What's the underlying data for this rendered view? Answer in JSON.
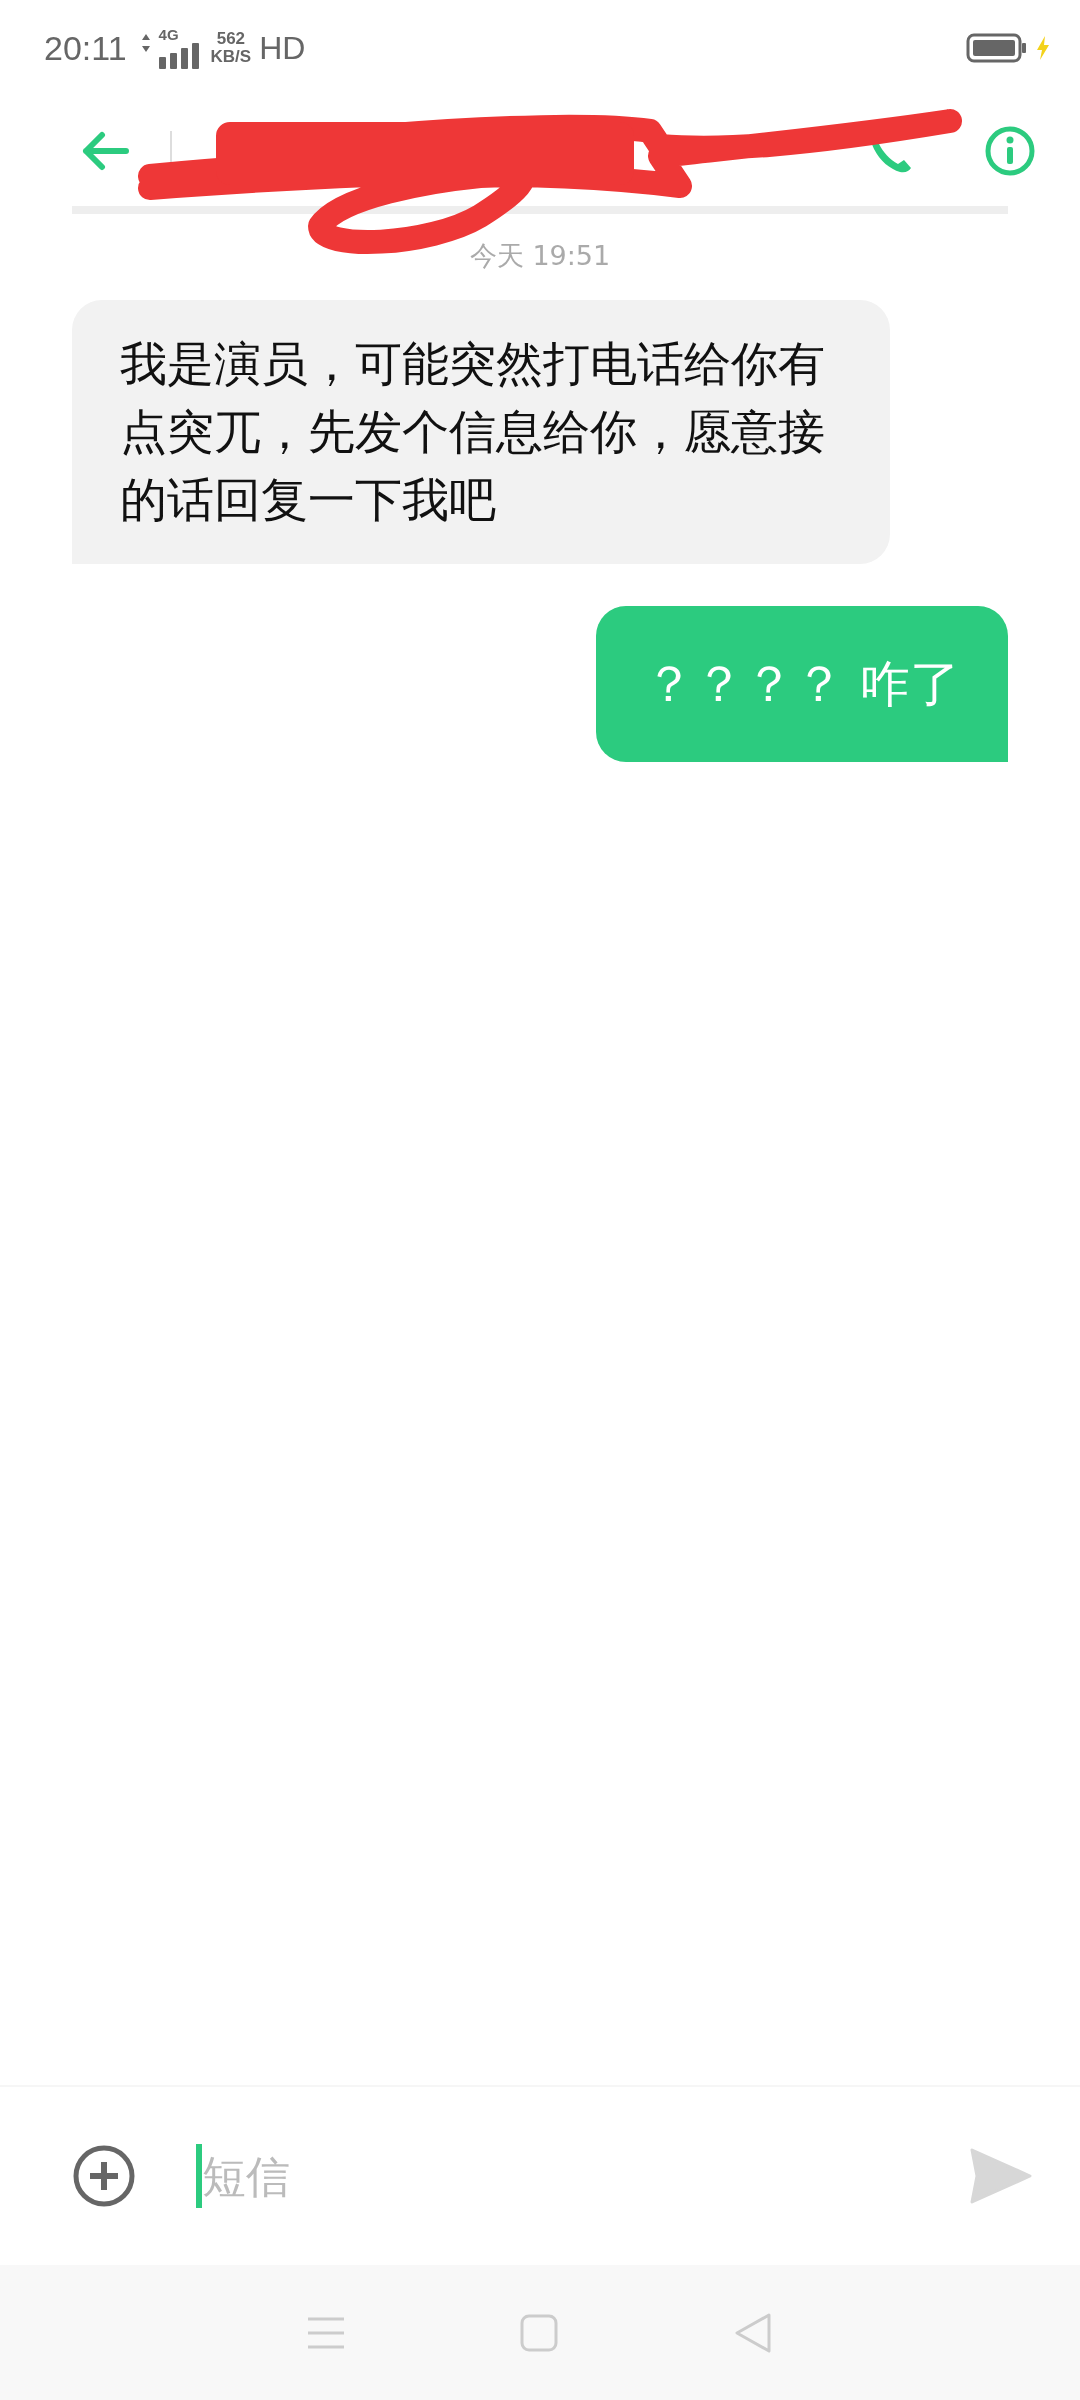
{
  "status_bar": {
    "time": "20:11",
    "network": "4G",
    "speed": "562",
    "speed_unit": "KB/S",
    "quality": "HD"
  },
  "messages": [
    {
      "kind": "timestamp",
      "text": "今天 19:51"
    },
    {
      "kind": "incoming",
      "text": "我是演员，可能突然打电话给你有点突兀，先发个信息给你，愿意接的话回复一下我吧"
    },
    {
      "kind": "outgoing",
      "text": "？？？？ 咋了"
    }
  ],
  "composer": {
    "placeholder": "短信"
  }
}
